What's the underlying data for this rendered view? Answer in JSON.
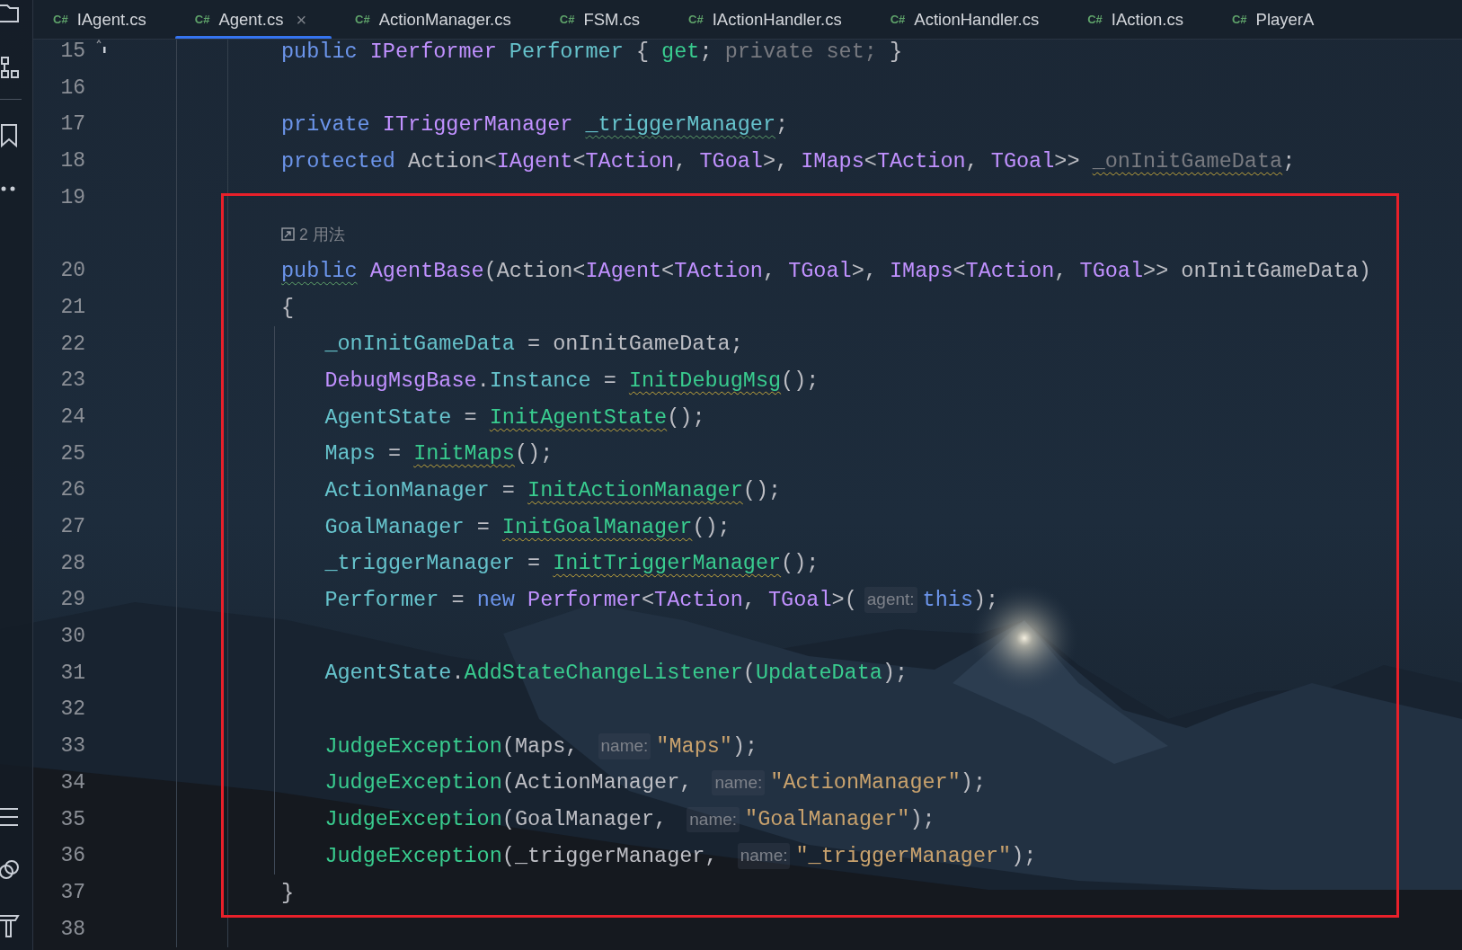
{
  "tabs": [
    {
      "lang": "C#",
      "label": "IAgent.cs",
      "selected": false
    },
    {
      "lang": "C#",
      "label": "Agent.cs",
      "selected": true,
      "close": "×"
    },
    {
      "lang": "C#",
      "label": "ActionManager.cs",
      "selected": false
    },
    {
      "lang": "C#",
      "label": "FSM.cs",
      "selected": false
    },
    {
      "lang": "C#",
      "label": "IActionHandler.cs",
      "selected": false
    },
    {
      "lang": "C#",
      "label": "ActionHandler.cs",
      "selected": false
    },
    {
      "lang": "C#",
      "label": "IAction.cs",
      "selected": false
    },
    {
      "lang": "C#",
      "label": "PlayerA",
      "selected": false
    }
  ],
  "lines": [
    {
      "kind": "code",
      "number": "15",
      "marker": true,
      "tokens": [
        {
          "t": "public ",
          "kind": "keyword"
        },
        {
          "t": "IPerformer ",
          "kind": "type"
        },
        {
          "t": "Performer",
          "kind": "field"
        },
        {
          "t": " { ",
          "kind": "plain"
        },
        {
          "t": "get",
          "kind": "method"
        },
        {
          "t": "; ",
          "kind": "plain"
        },
        {
          "t": "private set;",
          "kind": "muted"
        },
        {
          "t": " }",
          "kind": "plain"
        }
      ]
    },
    {
      "kind": "code",
      "number": "16"
    },
    {
      "kind": "code",
      "number": "17",
      "tokens": [
        {
          "t": "private ",
          "kind": "keyword"
        },
        {
          "t": "ITriggerManager ",
          "kind": "type"
        },
        {
          "t": "_triggerManager",
          "kind": "field",
          "typo": true
        },
        {
          "t": ";",
          "kind": "plain"
        }
      ]
    },
    {
      "kind": "code",
      "number": "18",
      "tokens": [
        {
          "t": "protected",
          "kind": "keyword"
        },
        {
          "t": " Action<",
          "kind": "plain"
        },
        {
          "t": "IAgent",
          "kind": "type"
        },
        {
          "t": "<",
          "kind": "plain"
        },
        {
          "t": "TAction",
          "kind": "type"
        },
        {
          "t": ", ",
          "kind": "plain"
        },
        {
          "t": "TGoal",
          "kind": "type"
        },
        {
          "t": ">, ",
          "kind": "plain"
        },
        {
          "t": "IMaps",
          "kind": "type"
        },
        {
          "t": "<",
          "kind": "plain"
        },
        {
          "t": "TAction",
          "kind": "type"
        },
        {
          "t": ", ",
          "kind": "plain"
        },
        {
          "t": "TGoal",
          "kind": "type"
        },
        {
          "t": ">> ",
          "kind": "plain"
        },
        {
          "t": "_onInitGameData",
          "kind": "muted",
          "warning": true
        },
        {
          "t": ";",
          "kind": "plain"
        }
      ]
    },
    {
      "kind": "code",
      "number": "19"
    },
    {
      "kind": "usages",
      "text": "2 用法"
    },
    {
      "kind": "code",
      "number": "20",
      "tokens": [
        {
          "t": "public",
          "kind": "keyword",
          "typo": true
        },
        {
          "t": " AgentBase",
          "kind": "type"
        },
        {
          "t": "(Action<",
          "kind": "plain"
        },
        {
          "t": "IAgent",
          "kind": "type"
        },
        {
          "t": "<",
          "kind": "plain"
        },
        {
          "t": "TAction",
          "kind": "type"
        },
        {
          "t": ", ",
          "kind": "plain"
        },
        {
          "t": "TGoal",
          "kind": "type"
        },
        {
          "t": ">, ",
          "kind": "plain"
        },
        {
          "t": "IMaps",
          "kind": "type"
        },
        {
          "t": "<",
          "kind": "plain"
        },
        {
          "t": "TAction",
          "kind": "type"
        },
        {
          "t": ", ",
          "kind": "plain"
        },
        {
          "t": "TGoal",
          "kind": "type"
        },
        {
          "t": ">> onInitGameData)",
          "kind": "plain"
        }
      ]
    },
    {
      "kind": "code",
      "number": "21",
      "tokens": [
        {
          "t": "{",
          "kind": "plain"
        }
      ],
      "children": [
        {
          "kind": "code",
          "number": "22",
          "tokens": [
            {
              "t": "_onInitGameData",
              "kind": "field"
            },
            {
              "t": " = onInitGameData;",
              "kind": "plain"
            }
          ]
        },
        {
          "kind": "code",
          "number": "23",
          "tokens": [
            {
              "t": "DebugMsgBase",
              "kind": "type"
            },
            {
              "t": ".",
              "kind": "plain"
            },
            {
              "t": "Instance",
              "kind": "field"
            },
            {
              "t": " = ",
              "kind": "plain"
            },
            {
              "t": "InitDebugMsg",
              "kind": "method",
              "warning": true
            },
            {
              "t": "();",
              "kind": "plain"
            }
          ]
        },
        {
          "kind": "code",
          "number": "24",
          "tokens": [
            {
              "t": "AgentState",
              "kind": "field"
            },
            {
              "t": " = ",
              "kind": "plain"
            },
            {
              "t": "InitAgentState",
              "kind": "method",
              "warning": true
            },
            {
              "t": "();",
              "kind": "plain"
            }
          ]
        },
        {
          "kind": "code",
          "number": "25",
          "tokens": [
            {
              "t": "Maps",
              "kind": "field"
            },
            {
              "t": " = ",
              "kind": "plain"
            },
            {
              "t": "InitMaps",
              "kind": "method",
              "warning": true
            },
            {
              "t": "();",
              "kind": "plain"
            }
          ]
        },
        {
          "kind": "code",
          "number": "26",
          "tokens": [
            {
              "t": "ActionManager",
              "kind": "field"
            },
            {
              "t": " = ",
              "kind": "plain"
            },
            {
              "t": "InitActionManager",
              "kind": "method",
              "warning": true
            },
            {
              "t": "();",
              "kind": "plain"
            }
          ]
        },
        {
          "kind": "code",
          "number": "27",
          "tokens": [
            {
              "t": "GoalManager",
              "kind": "field"
            },
            {
              "t": " = ",
              "kind": "plain"
            },
            {
              "t": "InitGoalManager",
              "kind": "method",
              "warning": true
            },
            {
              "t": "();",
              "kind": "plain"
            }
          ]
        },
        {
          "kind": "code",
          "number": "28",
          "tokens": [
            {
              "t": "_triggerManager",
              "kind": "field"
            },
            {
              "t": " = ",
              "kind": "plain"
            },
            {
              "t": "InitTriggerManager",
              "kind": "method",
              "warning": true
            },
            {
              "t": "();",
              "kind": "plain"
            }
          ]
        },
        {
          "kind": "code",
          "number": "29",
          "tokens": [
            {
              "t": "Performer",
              "kind": "field"
            },
            {
              "t": " = ",
              "kind": "plain"
            },
            {
              "t": "new ",
              "kind": "keyword"
            },
            {
              "t": "Performer",
              "kind": "type"
            },
            {
              "t": "<",
              "kind": "plain"
            },
            {
              "t": "TAction",
              "kind": "type"
            },
            {
              "t": ", ",
              "kind": "plain"
            },
            {
              "t": "TGoal",
              "kind": "type"
            },
            {
              "t": ">(",
              "kind": "plain"
            },
            {
              "t": "agent:",
              "kind": "hint"
            },
            {
              "t": "this",
              "kind": "keyword"
            },
            {
              "t": ");",
              "kind": "plain"
            }
          ]
        },
        {
          "kind": "code",
          "number": "30"
        },
        {
          "kind": "code",
          "number": "31",
          "tokens": [
            {
              "t": "AgentState",
              "kind": "field"
            },
            {
              "t": ".",
              "kind": "plain"
            },
            {
              "t": "AddStateChangeListener",
              "kind": "method"
            },
            {
              "t": "(",
              "kind": "plain"
            },
            {
              "t": "UpdateData",
              "kind": "method"
            },
            {
              "t": ");",
              "kind": "plain"
            }
          ]
        },
        {
          "kind": "code",
          "number": "32"
        },
        {
          "kind": "code",
          "number": "33",
          "tokens": [
            {
              "t": "JudgeException",
              "kind": "method"
            },
            {
              "t": "(Maps, ",
              "kind": "plain"
            },
            {
              "t": "name:",
              "kind": "hint"
            },
            {
              "t": "\"Maps\"",
              "kind": "string"
            },
            {
              "t": ");",
              "kind": "plain"
            }
          ]
        },
        {
          "kind": "code",
          "number": "34",
          "tokens": [
            {
              "t": "JudgeException",
              "kind": "method"
            },
            {
              "t": "(ActionManager, ",
              "kind": "plain"
            },
            {
              "t": "name:",
              "kind": "hint"
            },
            {
              "t": "\"ActionManager\"",
              "kind": "string"
            },
            {
              "t": ");",
              "kind": "plain"
            }
          ]
        },
        {
          "kind": "code",
          "number": "35",
          "tokens": [
            {
              "t": "JudgeException",
              "kind": "method"
            },
            {
              "t": "(GoalManager, ",
              "kind": "plain"
            },
            {
              "t": "name:",
              "kind": "hint"
            },
            {
              "t": "\"GoalManager\"",
              "kind": "string"
            },
            {
              "t": ");",
              "kind": "plain"
            }
          ]
        },
        {
          "kind": "code",
          "number": "36",
          "tokens": [
            {
              "t": "JudgeException",
              "kind": "method"
            },
            {
              "t": "(_triggerManager, ",
              "kind": "plain"
            },
            {
              "t": "name:",
              "kind": "hint"
            },
            {
              "t": "\"_triggerManager\"",
              "kind": "string"
            },
            {
              "t": ");",
              "kind": "plain"
            }
          ]
        }
      ]
    },
    {
      "kind": "code",
      "number": "37",
      "tokens": [
        {
          "t": "}",
          "kind": "plain"
        }
      ]
    },
    {
      "kind": "code",
      "number": "38"
    }
  ]
}
